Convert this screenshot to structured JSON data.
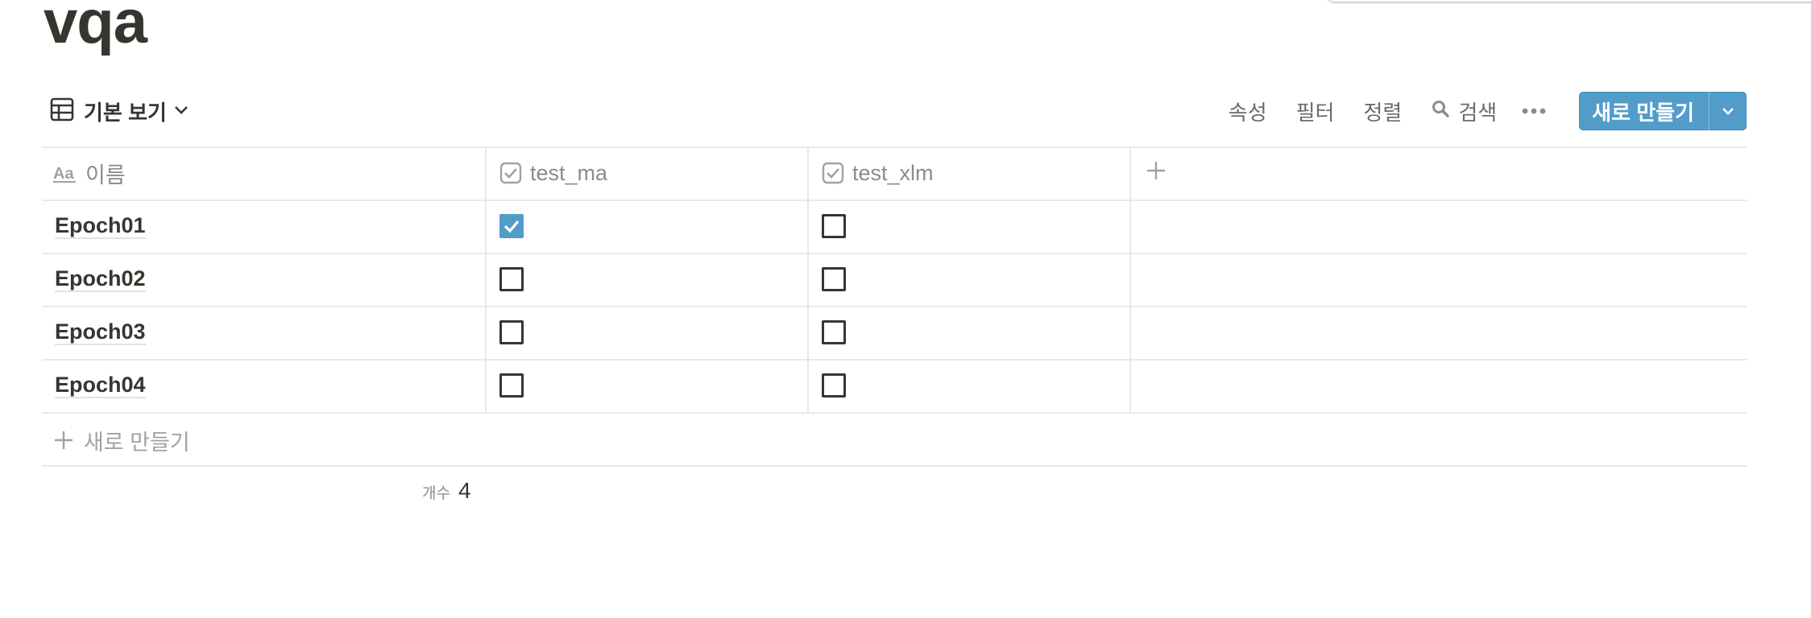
{
  "page": {
    "title": "vqa"
  },
  "toolbar": {
    "view_label": "기본 보기",
    "properties": "속성",
    "filter": "필터",
    "sort": "정렬",
    "search": "검색",
    "new_label": "새로 만들기",
    "accent": "#529cca"
  },
  "table": {
    "columns": [
      {
        "label": "이름",
        "icon": "text-aa-icon"
      },
      {
        "label": "test_ma",
        "icon": "checkbox-property-icon"
      },
      {
        "label": "test_xlm",
        "icon": "checkbox-property-icon"
      }
    ],
    "rows": [
      {
        "name": "Epoch01",
        "test_ma": true,
        "test_xlm": false
      },
      {
        "name": "Epoch02",
        "test_ma": false,
        "test_xlm": false
      },
      {
        "name": "Epoch03",
        "test_ma": false,
        "test_xlm": false
      },
      {
        "name": "Epoch04",
        "test_ma": false,
        "test_xlm": false
      }
    ],
    "add_row_label": "새로 만들기",
    "count_label": "개수",
    "count_value": "4"
  }
}
